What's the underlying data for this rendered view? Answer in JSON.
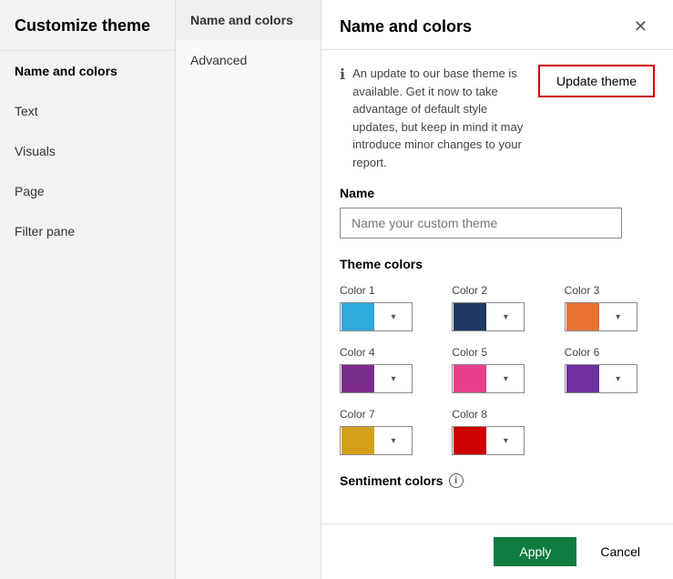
{
  "sidebar": {
    "title": "Customize theme",
    "items": [
      {
        "id": "name-and-colors",
        "label": "Name and colors",
        "active": true
      },
      {
        "id": "text",
        "label": "Text",
        "active": false
      },
      {
        "id": "visuals",
        "label": "Visuals",
        "active": false
      },
      {
        "id": "page",
        "label": "Page",
        "active": false
      },
      {
        "id": "filter-pane",
        "label": "Filter pane",
        "active": false
      }
    ]
  },
  "tabs": {
    "items": [
      {
        "id": "name-and-colors-tab",
        "label": "Name and colors",
        "active": true
      },
      {
        "id": "advanced-tab",
        "label": "Advanced",
        "active": false
      }
    ]
  },
  "main": {
    "title": "Name and colors",
    "close_label": "✕",
    "info_text": "An update to our base theme is available. Get it now to take advantage of default style updates, but keep in mind it may introduce minor changes to your report.",
    "update_theme_label": "Update theme",
    "name_section_label": "Name",
    "name_placeholder": "Name your custom theme",
    "theme_colors_label": "Theme colors",
    "colors": [
      {
        "id": "color1",
        "label": "Color 1",
        "value": "#2EAADC"
      },
      {
        "id": "color2",
        "label": "Color 2",
        "value": "#1F3864"
      },
      {
        "id": "color3",
        "label": "Color 3",
        "value": "#E97132"
      },
      {
        "id": "color4",
        "label": "Color 4",
        "value": "#7B2D8B"
      },
      {
        "id": "color5",
        "label": "Color 5",
        "value": "#E83E8C"
      },
      {
        "id": "color6",
        "label": "Color 6",
        "value": "#7030A0"
      },
      {
        "id": "color7",
        "label": "Color 7",
        "value": "#D4A017"
      },
      {
        "id": "color8",
        "label": "Color 8",
        "value": "#CC0000"
      }
    ],
    "sentiment_label": "Sentiment colors",
    "footer": {
      "apply_label": "Apply",
      "cancel_label": "Cancel"
    }
  }
}
